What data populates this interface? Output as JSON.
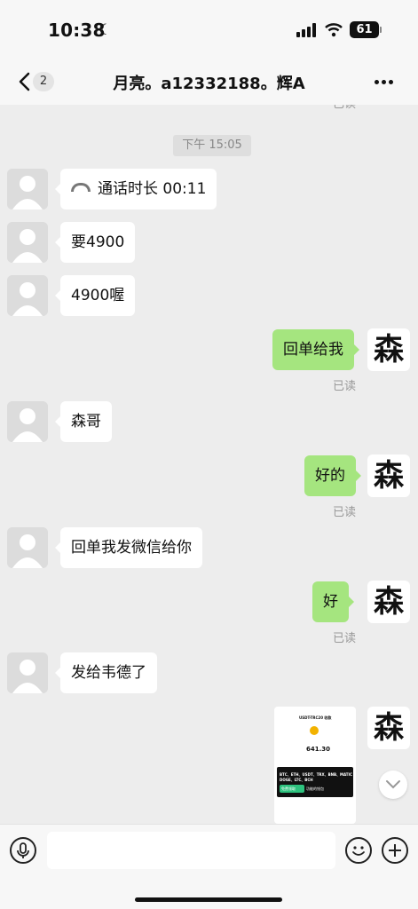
{
  "status_bar": {
    "time": "10:38",
    "moon_icon": "moon-icon",
    "battery": "61"
  },
  "nav": {
    "unread_count": "2",
    "title": "月亮。a12332188。辉A"
  },
  "messages": {
    "top_read": "已读",
    "timestamp": "下午 15:05",
    "call": {
      "icon": "phone-icon",
      "text": "通话时长 00:11"
    },
    "m1": "要4900",
    "m2": "4900喔",
    "r1": "回单给我",
    "r1_read": "已读",
    "m3": "森哥",
    "r2": "好的",
    "r2_read": "已读",
    "m4": "回单我发微信给你",
    "r3": "好",
    "r3_read": "已读",
    "m5": "发给韦德了",
    "my_avatar_char": "森"
  },
  "screenshot_thumb": {
    "header": "USDT-TRC20 收款",
    "amount": "641.30",
    "coins": "BTC、ETH、USDT、TRX、BNB、MATIC",
    "coins2": "DOGE、LTC、BCH",
    "tag": "免费领取",
    "tag_suffix": "功能的钱包"
  },
  "input": {
    "placeholder": ""
  },
  "colors": {
    "sent_bubble": "#a5e57f",
    "received_bubble": "#ffffff",
    "background": "#ededed"
  }
}
